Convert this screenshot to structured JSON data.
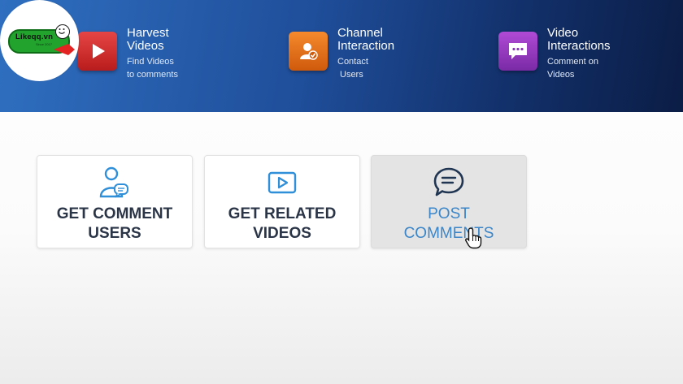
{
  "logo": {
    "text": "Likeqq.vn",
    "tagline": "Since 2017"
  },
  "features": [
    {
      "title_line1": "Harvest",
      "title_line2": "Videos",
      "sub_line1": "Find Videos",
      "sub_line2": "to comments",
      "icon": "play-icon"
    },
    {
      "title_line1": "Channel",
      "title_line2": "Interaction",
      "sub_line1": "Contact",
      "sub_line2": "Users",
      "icon": "user-check-icon"
    },
    {
      "title_line1": "Video",
      "title_line2": "Interactions",
      "sub_line1": "Comment on",
      "sub_line2": "Videos",
      "icon": "comment-dots-icon"
    }
  ],
  "cards": [
    {
      "label": "GET COMMENT\nUSERS",
      "icon": "user-comment-icon"
    },
    {
      "label": "GET RELATED\nVIDEOS",
      "icon": "video-play-icon"
    },
    {
      "label": "POST\nCOMMENTS",
      "icon": "chat-bubble-icon"
    }
  ],
  "colors": {
    "banner_start": "#2f6fc0",
    "banner_end": "#0b1d45",
    "card_text": "#2b3548",
    "active_text": "#3b86c9",
    "icon_blue": "#2f8fd8"
  }
}
